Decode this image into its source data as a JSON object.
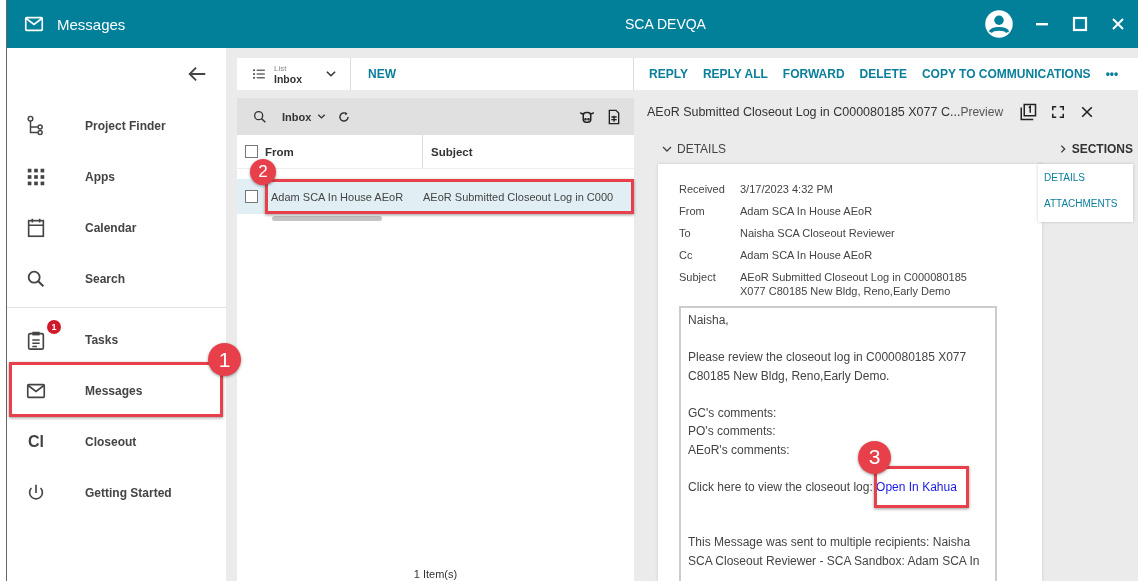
{
  "window": {
    "title": "Messages",
    "environment": "SCA DEVQA"
  },
  "sidebar": {
    "groups": [
      [
        {
          "label": "Project Finder"
        },
        {
          "label": "Apps"
        },
        {
          "label": "Calendar"
        },
        {
          "label": "Search"
        }
      ],
      [
        {
          "label": "Tasks",
          "badge": "1"
        },
        {
          "label": "Messages",
          "callout": "1"
        },
        {
          "label": "Closeout",
          "icon_text": "Cl"
        },
        {
          "label": "Getting Started"
        }
      ]
    ]
  },
  "list_toolbar": {
    "view_label": "List",
    "view_value": "Inbox",
    "new_label": "NEW"
  },
  "actions": [
    "REPLY",
    "REPLY ALL",
    "FORWARD",
    "DELETE",
    "COPY TO COMMUNICATIONS",
    "•••"
  ],
  "message_list": {
    "folder": "Inbox",
    "all_checked": false,
    "columns": [
      "From",
      "Subject"
    ],
    "rows": [
      {
        "from": "Adam SCA In House AEoR",
        "subject": "AEoR Submitted Closeout Log in C000",
        "selected": true,
        "checked": false,
        "callout": "2"
      }
    ],
    "footer": "1 Item(s)"
  },
  "preview": {
    "title": "AEoR Submitted Closeout Log in C000080185 X077 C...",
    "mode": "Preview",
    "section_heading": "DETAILS",
    "expanded": true,
    "sections_toggle": "SECTIONS",
    "sections": [
      "DETAILS",
      "ATTACHMENTS"
    ],
    "fields": [
      {
        "label": "Received",
        "value": "3/17/2023 4:32 PM"
      },
      {
        "label": "From",
        "value": "Adam SCA In House AEoR"
      },
      {
        "label": "To",
        "value": "Naisha SCA Closeout Reviewer"
      },
      {
        "label": "Cc",
        "value": "Adam SCA In House AEoR"
      },
      {
        "label": "Subject",
        "value": "AEoR Submitted Closeout Log in C000080185 X077 C80185 New Bldg, Reno,Early Demo"
      }
    ],
    "body": [
      {
        "kind": "text",
        "text": "Naisha,"
      },
      {
        "kind": "blank"
      },
      {
        "kind": "text",
        "text": "Please review the closeout log in C000080185 X077 C80185 New Bldg, Reno,Early Demo."
      },
      {
        "kind": "blank"
      },
      {
        "kind": "text",
        "text": "GC's comments:"
      },
      {
        "kind": "text",
        "text": "PO's comments:"
      },
      {
        "kind": "text",
        "text": "AEoR's comments:"
      },
      {
        "kind": "blank"
      },
      {
        "kind": "link",
        "text": "Click here to view the closeout log: ",
        "link": "Open In Kahua",
        "callout": "3"
      },
      {
        "kind": "blank"
      },
      {
        "kind": "blank"
      },
      {
        "kind": "text",
        "text": "This Message was sent to multiple recipients: Naisha SCA Closeout Reviewer - SCA Sandbox: Adam SCA In"
      }
    ]
  }
}
